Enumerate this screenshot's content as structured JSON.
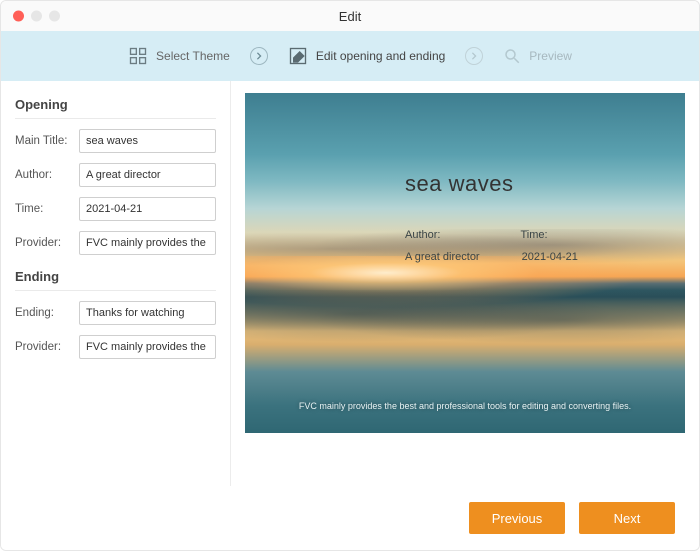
{
  "window": {
    "title": "Edit"
  },
  "steps": {
    "select_theme": "Select Theme",
    "edit_opening_ending": "Edit opening and ending",
    "preview": "Preview"
  },
  "sidebar": {
    "opening": {
      "heading": "Opening",
      "main_title_label": "Main Title:",
      "main_title_value": "sea waves",
      "author_label": "Author:",
      "author_value": "A great director",
      "time_label": "Time:",
      "time_value": "2021-04-21",
      "provider_label": "Provider:",
      "provider_value": "FVC mainly provides the best a"
    },
    "ending": {
      "heading": "Ending",
      "ending_label": "Ending:",
      "ending_value": "Thanks for watching",
      "provider_label": "Provider:",
      "provider_value": "FVC mainly provides the best a"
    }
  },
  "preview": {
    "title": "sea waves",
    "author_label": "Author:",
    "time_label": "Time:",
    "author_value": "A great director",
    "time_value": "2021-04-21",
    "footer_text": "FVC mainly provides the best and professional tools for editing and converting files."
  },
  "footer": {
    "previous": "Previous",
    "next": "Next"
  }
}
